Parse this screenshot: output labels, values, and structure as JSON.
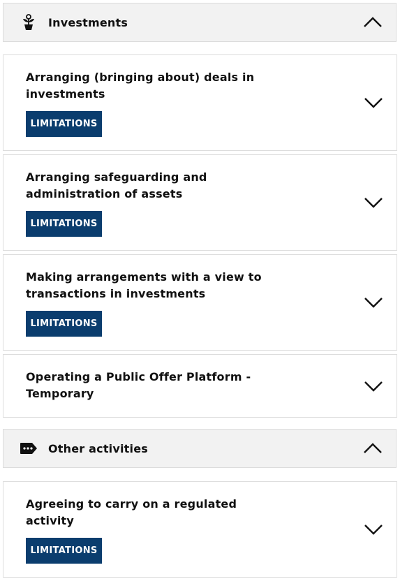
{
  "sections": [
    {
      "title": "Investments",
      "icon": "plant-icon",
      "expanded": true,
      "items": [
        {
          "title": "Arranging (bringing about) deals in investments",
          "badge": "LIMITATIONS"
        },
        {
          "title": "Arranging safeguarding and administration of assets",
          "badge": "LIMITATIONS"
        },
        {
          "title": "Making arrangements with a view to transactions in investments",
          "badge": "LIMITATIONS"
        },
        {
          "title": "Operating a Public Offer Platform - Temporary",
          "badge": null
        }
      ]
    },
    {
      "title": "Other activities",
      "icon": "tag-icon",
      "expanded": true,
      "items": [
        {
          "title": "Agreeing to carry on a regulated activity",
          "badge": "LIMITATIONS"
        }
      ]
    }
  ],
  "colors": {
    "badge_bg": "#0b3d6e",
    "header_bg": "#f2f2f2"
  }
}
